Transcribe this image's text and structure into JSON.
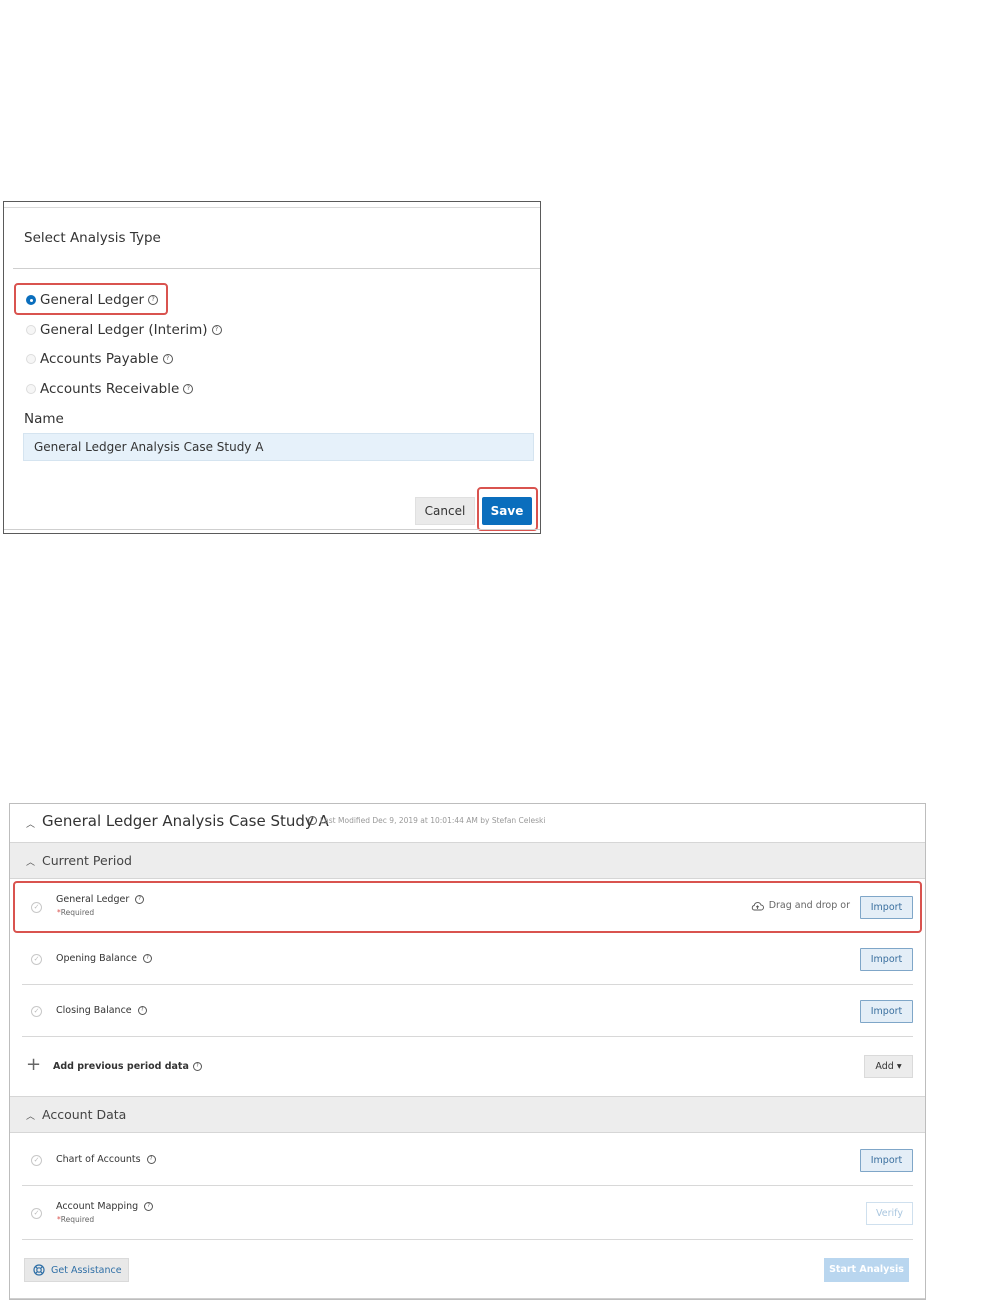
{
  "dialog": {
    "title": "Select Analysis Type",
    "options": [
      {
        "label": "General Ledger",
        "selected": true
      },
      {
        "label": "General Ledger (Interim)",
        "selected": false
      },
      {
        "label": "Accounts Payable",
        "selected": false
      },
      {
        "label": "Accounts Receivable",
        "selected": false
      }
    ],
    "name_label": "Name",
    "name_value": "General Ledger Analysis Case Study A",
    "cancel_label": "Cancel",
    "save_label": "Save",
    "help_glyph": "?"
  },
  "panel": {
    "title": "General Ledger Analysis Case Study A",
    "meta": "Last Modified Dec 9, 2019 at 10:01:44 AM by Stefan Celeski",
    "current_period": {
      "title": "Current Period",
      "rows": [
        {
          "label": "General Ledger",
          "required": "Required",
          "drag_text": "Drag and drop or",
          "button": "Import"
        },
        {
          "label": "Opening Balance",
          "button": "Import"
        },
        {
          "label": "Closing Balance",
          "button": "Import"
        }
      ],
      "add_label": "Add previous period data",
      "add_button": "Add ▾"
    },
    "account_data": {
      "title": "Account Data",
      "rows": [
        {
          "label": "Chart of Accounts",
          "button": "Import"
        },
        {
          "label": "Account Mapping",
          "required": "Required",
          "button": "Verify"
        }
      ]
    },
    "assist_label": "Get Assistance",
    "start_label": "Start Analysis"
  },
  "colors": {
    "primary": "#0a6ebd",
    "highlight": "#d9534f",
    "import_border": "#7fa6c8",
    "disabled_primary": "#b9d6ef"
  },
  "icons": [
    "help-icon",
    "chevron-up-icon",
    "check-circle-icon",
    "cloud-upload-icon",
    "plus-icon",
    "lifebuoy-icon"
  ]
}
